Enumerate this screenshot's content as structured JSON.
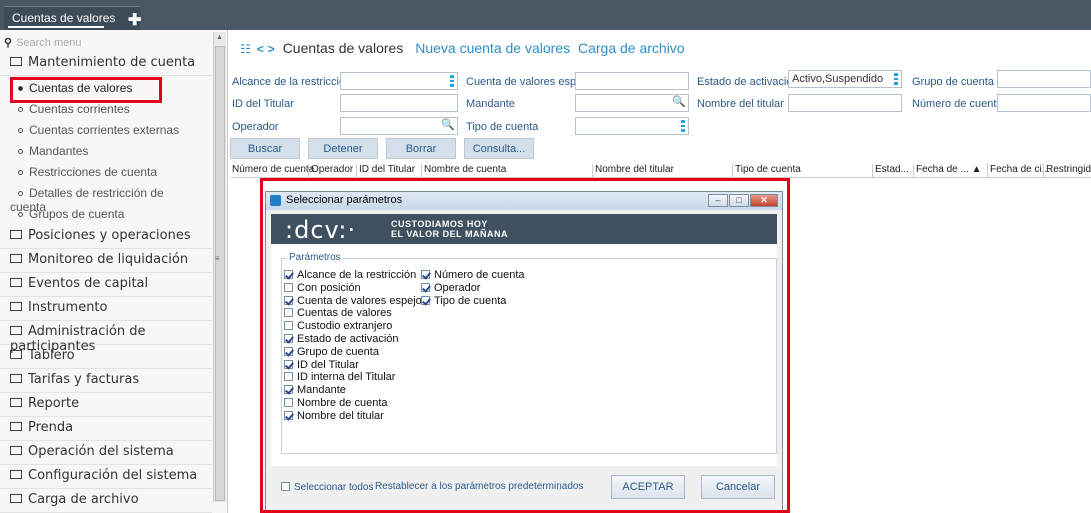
{
  "topbar": {
    "tab_label": "Cuentas de valores",
    "add_label": "✚"
  },
  "sidebar": {
    "search_placeholder": "Search menu",
    "sections": [
      "Mantenimiento de cuenta",
      "Posiciones y operaciones",
      "Monitoreo de liquidación",
      "Eventos de capital",
      "Instrumento",
      "Administración de participantes",
      "Tablero",
      "Tarifas y facturas",
      "Reporte",
      "Prenda",
      "Operación del sistema",
      "Configuración del sistema",
      "Carga de archivo"
    ],
    "subitems": [
      "Cuentas de valores",
      "Cuentas corrientes",
      "Cuentas corrientes externas",
      "Mandantes",
      "Restricciones de cuenta",
      "Detalles de restricción de cuenta",
      "Grupos de cuenta"
    ]
  },
  "main": {
    "title": "Cuentas de valores",
    "link_new": "Nueva cuenta de valores",
    "link_upload": "Carga de archivo",
    "labels": {
      "alcance": "Alcance de la restricción",
      "espejo": "Cuenta de valores espejo",
      "estado": "Estado de activación",
      "grupo": "Grupo de cuenta",
      "id_titular": "ID del Titular",
      "mandante": "Mandante",
      "nombre_titular": "Nombre del titular",
      "numero": "Número de cuenta",
      "operador": "Operador",
      "tipo": "Tipo de cuenta"
    },
    "estado_value": "Activo,Suspendido",
    "buttons": {
      "buscar": "Buscar",
      "detener": "Detener",
      "borrar": "Borrar",
      "consulta": "Consulta..."
    },
    "columns": [
      "Número de cuenta",
      "Operador",
      "ID del Titular",
      "Nombre de cuenta",
      "Nombre del titular",
      "Tipo de cuenta",
      "Estad...",
      "Fecha de ... ▲",
      "Fecha de ci...",
      "Restringido"
    ]
  },
  "dialog": {
    "title": "Seleccionar parámetros",
    "brand": ":dcv:·",
    "tagline1": "CUSTODIAMOS HOY",
    "tagline2": "EL VALOR DEL MAÑANA",
    "legend": "Parámetros",
    "params_col1": [
      {
        "label": "Alcance de la restricción",
        "checked": true
      },
      {
        "label": "Con posición",
        "checked": false
      },
      {
        "label": "Cuenta de valores espejo",
        "checked": true
      },
      {
        "label": "Cuentas de valores",
        "checked": false
      },
      {
        "label": "Custodio extranjero",
        "checked": false
      },
      {
        "label": "Estado de activación",
        "checked": true
      },
      {
        "label": "Grupo de cuenta",
        "checked": true
      },
      {
        "label": "ID del Titular",
        "checked": true
      },
      {
        "label": "ID interna del Titular",
        "checked": false
      },
      {
        "label": "Mandante",
        "checked": true
      },
      {
        "label": "Nombre de cuenta",
        "checked": false
      },
      {
        "label": "Nombre del titular",
        "checked": true
      }
    ],
    "params_col2": [
      {
        "label": "Número de cuenta",
        "checked": true
      },
      {
        "label": "Operador",
        "checked": true
      },
      {
        "label": "Tipo de cuenta",
        "checked": true
      }
    ],
    "select_all": "Seleccionar todos",
    "reset": "Restablecer a los parámetros predeterminados",
    "accept": "ACEPTAR",
    "cancel": "Cancelar"
  }
}
